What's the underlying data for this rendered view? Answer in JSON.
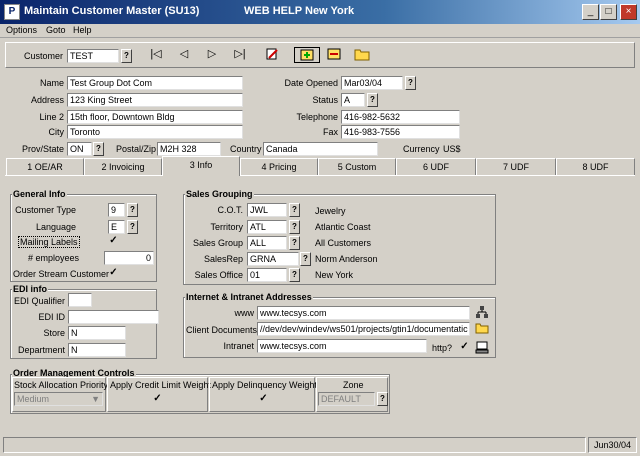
{
  "window": {
    "title": "Maintain Customer Master (SU13)",
    "help": "WEB HELP",
    "location": "New York",
    "controls": {
      "minimize": "_",
      "maximize": "□",
      "close": "×"
    }
  },
  "menu": [
    "Options",
    "Goto",
    "Help"
  ],
  "toolbar": {
    "customer_label": "Customer",
    "customer_value": "TEST",
    "q": "?",
    "first": "|◁",
    "prev": "◁",
    "next": "▷",
    "last": "▷|"
  },
  "customer": {
    "name_label": "Name",
    "name": "Test Group Dot Com",
    "address_label": "Address",
    "address": "123 King Street",
    "line2_label": "Line 2",
    "line2": "15th floor, Downtown Bldg",
    "city_label": "City",
    "city": "Toronto",
    "prov_label": "Prov/State",
    "prov": "ON",
    "postal_label": "Postal/Zip",
    "postal": "M2H 328",
    "country_label": "Country",
    "country": "Canada",
    "date_opened_label": "Date Opened",
    "date_opened": "Mar03/04",
    "status_label": "Status",
    "status": "A",
    "telephone_label": "Telephone",
    "telephone": "416-982-5632",
    "fax_label": "Fax",
    "fax": "416-983-7556",
    "currency_label": "Currency",
    "currency": "US$"
  },
  "tabs": [
    {
      "label": "1 OE/AR"
    },
    {
      "label": "2 Invoicing"
    },
    {
      "label": "3 Info"
    },
    {
      "label": "4 Pricing"
    },
    {
      "label": "5 Custom"
    },
    {
      "label": "6 UDF"
    },
    {
      "label": "7 UDF"
    },
    {
      "label": "8 UDF"
    }
  ],
  "general_info": {
    "title": "General Info",
    "customer_type_label": "Customer Type",
    "customer_type": "9",
    "language_label": "Language",
    "language": "E",
    "mailing_labels_label": "Mailing Labels",
    "mailing_labels": "✓",
    "employees_label": "# employees",
    "employees": "0",
    "order_stream_label": "Order Stream Customer",
    "order_stream": "✓"
  },
  "edi_info": {
    "title": "EDI info",
    "qualifier_label": "EDI Qualifier",
    "qualifier": "",
    "id_label": "EDI ID",
    "id": "",
    "store_label": "Store",
    "store": "N",
    "department_label": "Department",
    "department": "N"
  },
  "sales_grouping": {
    "title": "Sales Grouping",
    "rows": [
      {
        "label": "C.O.T.",
        "code": "JWL",
        "desc": "Jewelry"
      },
      {
        "label": "Territory",
        "code": "ATL",
        "desc": "Atlantic Coast"
      },
      {
        "label": "Sales Group",
        "code": "ALL",
        "desc": "All Customers"
      },
      {
        "label": "SalesRep",
        "code": "GRNA",
        "desc": "Norm Anderson"
      },
      {
        "label": "Sales Office",
        "code": "01",
        "desc": "New York"
      }
    ]
  },
  "internet": {
    "title": "Internet & Intranet Addresses",
    "www_label": "www",
    "www": "www.tecsys.com",
    "docs_label": "Client Documents",
    "docs": "//dev/dev/windev/ws501/projects/gtin1/documentatic",
    "intranet_label": "Intranet",
    "intranet": "www.tecsys.com",
    "http_label": "http?",
    "http": "✓"
  },
  "order_mgmt": {
    "title": "Order Management Controls",
    "stock_label": "Stock Allocation Priority",
    "stock": "Medium",
    "credit_label": "Apply Credit Limit Weight",
    "credit": "✓",
    "delinq_label": "Apply Delinquency Weight",
    "delinq": "✓",
    "zone_label": "Zone",
    "zone": "DEFAULT"
  },
  "statusbar": {
    "date": "Jun30/04"
  }
}
